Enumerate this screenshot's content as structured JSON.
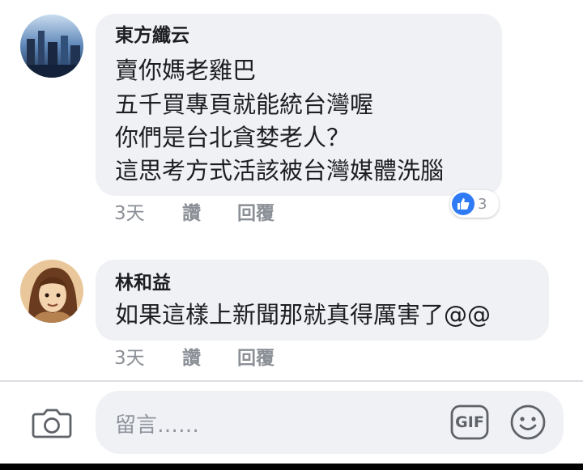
{
  "comments": [
    {
      "author": "東方纖云",
      "lines": [
        "賣你媽老雞巴",
        "五千買專頁就能統台灣喔",
        "你們是台北貪婪老人？",
        "這思考方式活該被台灣媒體洗腦"
      ],
      "time": "3天",
      "like_label": "讚",
      "reply_label": "回覆",
      "reaction_count": "3"
    },
    {
      "author": "林和益",
      "lines": [
        "如果這樣上新聞那就真得厲害了@@"
      ],
      "time": "3天",
      "like_label": "讚",
      "reply_label": "回覆"
    }
  ],
  "composer": {
    "placeholder": "留言……",
    "gif_label": "GIF"
  },
  "colors": {
    "bubble": "#f0f1f4",
    "like_blue": "#2f7af5",
    "meta_gray": "#8b8f96"
  }
}
